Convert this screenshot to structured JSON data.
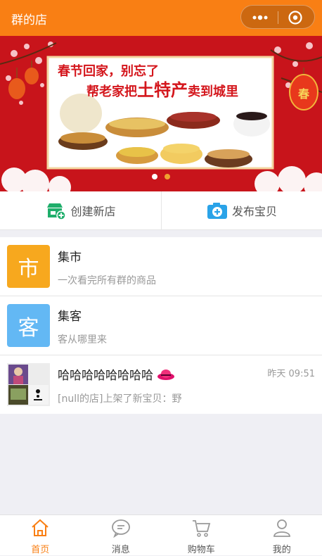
{
  "nav": {
    "title": "群的店"
  },
  "banner": {
    "line1": "春节回家，别忘了",
    "line2_pre": "帮老家把",
    "line2_highlight": "土特产",
    "line2_post": "卖到城里",
    "lantern_char": "春",
    "dots": [
      {
        "active": false
      },
      {
        "active": true
      }
    ],
    "colors": {
      "red": "#c8141b",
      "accent": "#f0a030"
    }
  },
  "actions": {
    "create_store": "创建新店",
    "publish_item": "发布宝贝"
  },
  "list": [
    {
      "avatar_char": "市",
      "avatar_color": "#f7a81e",
      "title": "集市",
      "subtitle": "一次看完所有群的商品",
      "time": ""
    },
    {
      "avatar_char": "客",
      "avatar_color": "#63b8f4",
      "title": "集客",
      "subtitle": "客从哪里来",
      "time": ""
    },
    {
      "avatar_char": "",
      "avatar_color": "",
      "title": "哈哈哈哈哈哈哈哈",
      "subtitle": "[null的店]上架了新宝贝：野",
      "time": "昨天 09:51"
    }
  ],
  "tabbar": [
    {
      "label": "首页",
      "icon": "home-icon",
      "active": true
    },
    {
      "label": "消息",
      "icon": "message-icon",
      "active": false
    },
    {
      "label": "购物车",
      "icon": "cart-icon",
      "active": false
    },
    {
      "label": "我的",
      "icon": "user-icon",
      "active": false
    }
  ],
  "colors": {
    "brand": "#f97f14",
    "background": "#efeff4"
  }
}
